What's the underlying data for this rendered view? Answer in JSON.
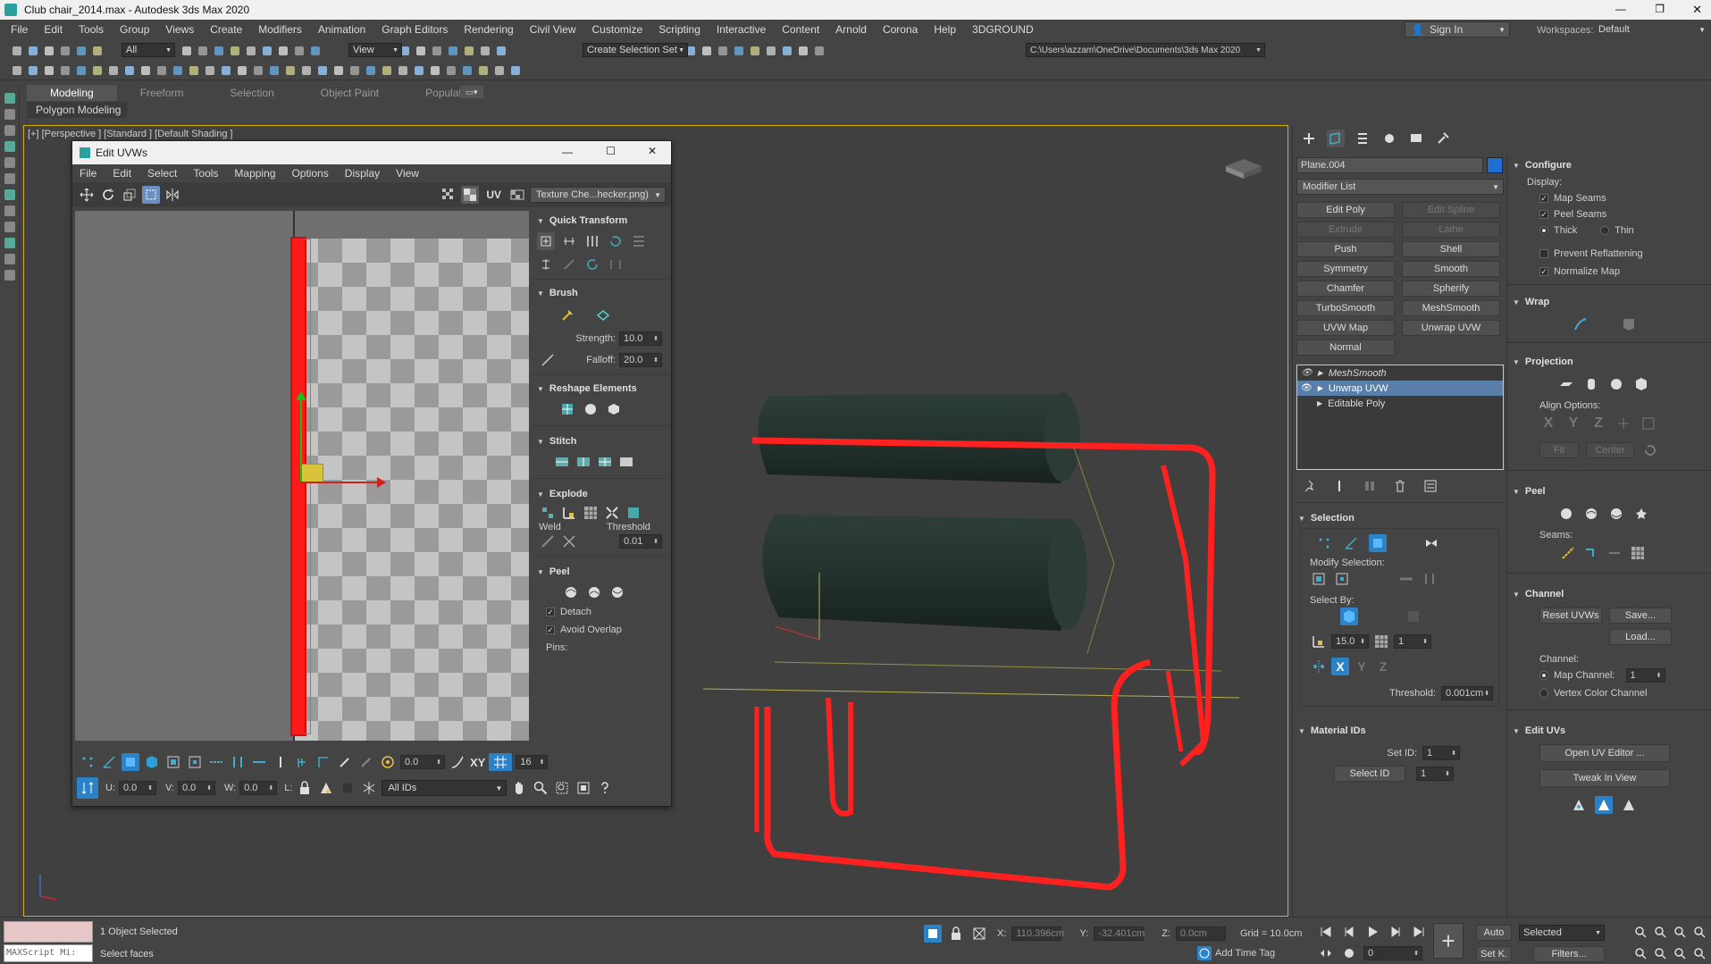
{
  "window": {
    "title": "Club chair_2014.max - Autodesk 3ds Max 2020",
    "min": "—",
    "max": "❐",
    "close": "✕"
  },
  "menubar": [
    "File",
    "Edit",
    "Tools",
    "Group",
    "Views",
    "Create",
    "Modifiers",
    "Animation",
    "Graph Editors",
    "Rendering",
    "Civil View",
    "Customize",
    "Scripting",
    "Interactive",
    "Content",
    "Arnold",
    "Corona",
    "Help",
    "3DGROUND"
  ],
  "signin": "Sign In",
  "workspaces_label": "Workspaces:",
  "workspace": "Default",
  "toolbar": {
    "filter": "All",
    "refcoord": "View",
    "selection_set": "Create Selection Set",
    "path": "C:\\Users\\azzam\\OneDrive\\Documents\\3ds Max 2020"
  },
  "ribbon_tabs": [
    "Modeling",
    "Freeform",
    "Selection",
    "Object Paint",
    "Populate"
  ],
  "ribbon_sub": "Polygon Modeling",
  "viewport": {
    "label": "[+] [Perspective ] [Standard ] [Default Shading ]"
  },
  "uvw": {
    "title": "Edit UVWs",
    "menu": [
      "File",
      "Edit",
      "Select",
      "Tools",
      "Mapping",
      "Options",
      "Display",
      "View"
    ],
    "uv": "UV",
    "texture": "Texture Che...hecker.png)",
    "quick_transform": "Quick Transform",
    "brush": "Brush",
    "strength_label": "Strength:",
    "strength": "10.0",
    "falloff_label": "Falloff:",
    "falloff": "20.0",
    "reshape": "Reshape Elements",
    "stitch": "Stitch",
    "explode": "Explode",
    "weld": "Weld",
    "threshold_label": "Threshold",
    "threshold": "0.01",
    "peel": "Peel",
    "detach": "Detach",
    "avoid_overlap": "Avoid Overlap",
    "pins": "Pins:",
    "angle": "0.0",
    "grid_count": "16",
    "u_label": "U:",
    "u": "0.0",
    "v_label": "V:",
    "v": "0.0",
    "w_label": "W:",
    "w": "0.0",
    "l_label": "L:",
    "ids": "All IDs",
    "xy": "XY"
  },
  "cmd": {
    "object_name": "Plane.004",
    "object_color": "#1f6fd1",
    "modifier_list": "Modifier List",
    "mod_buttons": [
      [
        "Edit Poly",
        "Edit Spline"
      ],
      [
        "Extrude",
        "Lathe"
      ],
      [
        "Push",
        "Shell"
      ],
      [
        "Symmetry",
        "Smooth"
      ],
      [
        "Chamfer",
        "Spherify"
      ],
      [
        "TurboSmooth",
        "MeshSmooth"
      ],
      [
        "UVW Map",
        "Unwrap UVW"
      ],
      [
        "Normal",
        ""
      ]
    ],
    "stack": [
      "MeshSmooth",
      "Unwrap UVW",
      "Editable Poly"
    ],
    "selection": "Selection",
    "modify_selection": "Modify Selection:",
    "select_by": "Select By:",
    "angle": "15.0",
    "count": "1",
    "threshold_label": "Threshold:",
    "threshold": "0.001cm",
    "material_ids": "Material IDs",
    "set_id_label": "Set ID:",
    "set_id": "1",
    "select_id": "Select ID",
    "select_id_val": "1"
  },
  "right": {
    "configure": "Configure",
    "display": "Display:",
    "map_seams": "Map Seams",
    "peel_seams": "Peel Seams",
    "thick": "Thick",
    "thin": "Thin",
    "prevent": "Prevent Reflattening",
    "normalize": "Normalize Map",
    "wrap": "Wrap",
    "projection": "Projection",
    "align_options": "Align Options:",
    "fit": "Fit",
    "center": "Center",
    "peel": "Peel",
    "seams": "Seams:",
    "channel": "Channel",
    "reset_uvws": "Reset UVWs",
    "save": "Save...",
    "load": "Load...",
    "channel_label": "Channel:",
    "map_channel": "Map Channel:",
    "map_channel_val": "1",
    "vertex_color": "Vertex Color Channel",
    "edit_uvs": "Edit UVs",
    "open_uv": "Open UV Editor ...",
    "tweak": "Tweak In View"
  },
  "status": {
    "objects": "1 Object Selected",
    "prompt": "Select faces",
    "maxscript": "MAXScript Mi:",
    "x_label": "X:",
    "x": "110.396cm",
    "y_label": "Y:",
    "y": "-32.401cm",
    "z_label": "Z:",
    "z": "0.0cm",
    "grid": "Grid = 10.0cm",
    "add_time_tag": "Add Time Tag",
    "auto": "Auto",
    "selected": "Selected",
    "set_k": "Set K.",
    "filters": "Filters...",
    "frame": "0"
  },
  "colors": {
    "accent": "#1f6fd1",
    "seam": "#ff2020",
    "chair": "#24332d"
  }
}
